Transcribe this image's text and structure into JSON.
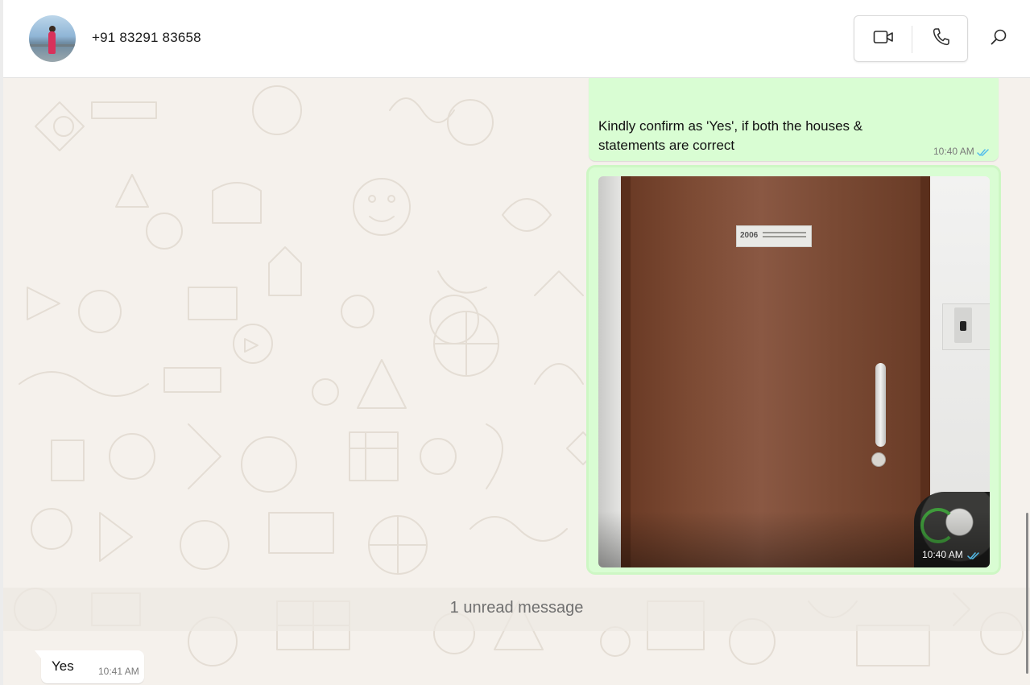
{
  "contact": {
    "name": "+91 83291 83658"
  },
  "header": {
    "video_icon": "video-camera-icon",
    "phone_icon": "phone-icon",
    "search_icon": "search-icon"
  },
  "messages": [
    {
      "direction": "outgoing",
      "text": "Kindly confirm as 'Yes', if both the houses & statements are correct",
      "time": "10:40 AM",
      "status": "read"
    },
    {
      "direction": "outgoing",
      "type": "image",
      "image_plate_text": "2006",
      "time": "10:40 AM",
      "status": "read"
    }
  ],
  "unread_banner": {
    "text": "1 unread message"
  },
  "incoming": {
    "text": "Yes",
    "time": "10:41 AM"
  },
  "colors": {
    "outgoing_bubble": "#d9fdd3",
    "chat_background": "#f5f1ec",
    "read_tick": "#53bdeb"
  }
}
